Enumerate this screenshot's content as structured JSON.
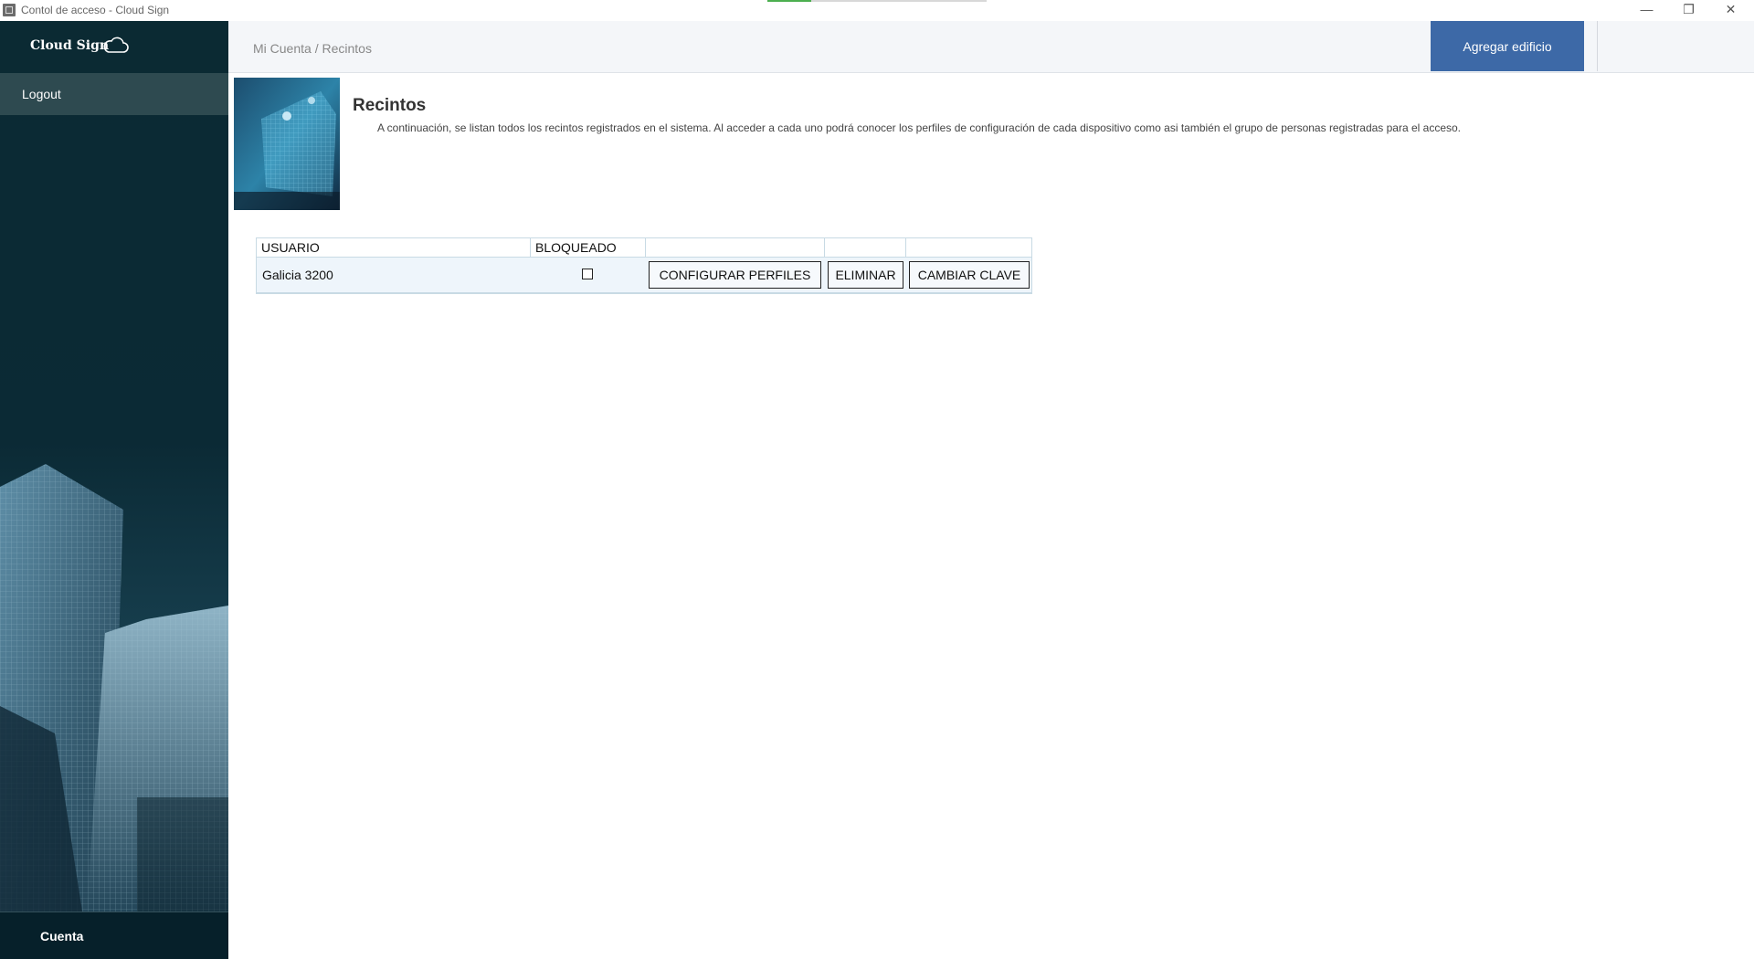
{
  "window": {
    "title": "Contol de acceso - Cloud Sign",
    "progress": 0.2,
    "controls": {
      "minimize": "—",
      "maximize": "❐",
      "close": "✕"
    }
  },
  "sidebar": {
    "brand": "Cloud Sign",
    "brand_icon": "cloud-icon",
    "logout": "Logout",
    "footer": "Cuenta"
  },
  "header": {
    "breadcrumb": "Mi Cuenta / Recintos",
    "add_button": "Agregar edificio"
  },
  "page": {
    "title": "Recintos",
    "description": "A continuación, se listan todos los recintos registrados en el sistema. Al acceder a cada uno podrá conocer los perfiles de configuración de cada dispositivo como asi también el grupo de personas registradas para el acceso."
  },
  "table": {
    "columns": [
      "USUARIO",
      "BLOQUEADO",
      "",
      "",
      ""
    ],
    "rows": [
      {
        "usuario": "Galicia 3200",
        "bloqueado": false,
        "configurar": "CONFIGURAR PERFILES",
        "eliminar": "ELIMINAR",
        "cambiar_clave": "CAMBIAR CLAVE"
      }
    ]
  },
  "colors": {
    "sidebar_bg": "#0b2a33",
    "logout_bg": "#2e4a50",
    "accent_button": "#3d69a7",
    "header_bg": "#f4f6f9",
    "row_bg": "#eef5fb"
  }
}
